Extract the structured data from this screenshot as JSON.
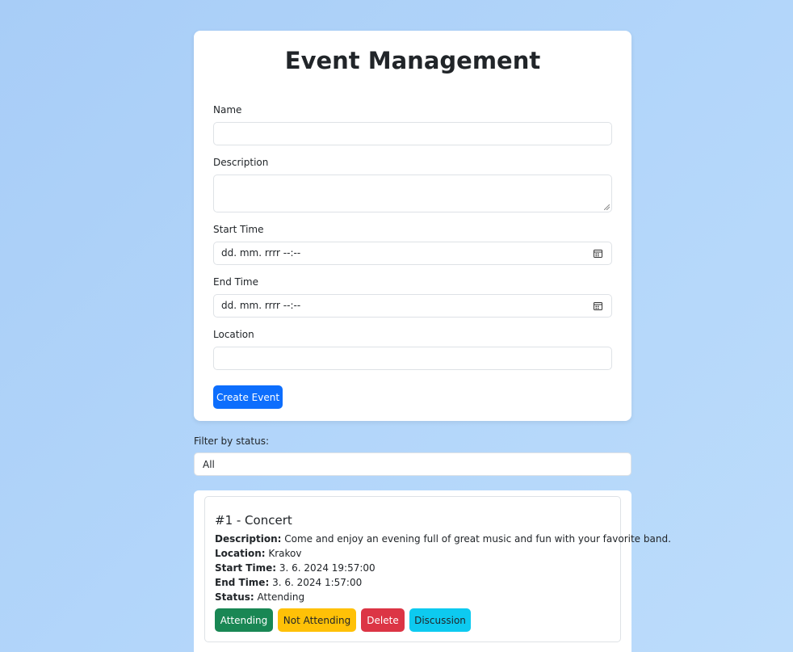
{
  "page": {
    "title": "Event Management"
  },
  "form": {
    "name_label": "Name",
    "name_value": "",
    "description_label": "Description",
    "description_value": "",
    "start_label": "Start Time",
    "start_placeholder": "dd. mm. rrrr --:--",
    "end_label": "End Time",
    "end_placeholder": "dd. mm. rrrr --:--",
    "location_label": "Location",
    "location_value": "",
    "submit_label": "Create Event"
  },
  "filter": {
    "label": "Filter by status:",
    "selected": "All"
  },
  "events": [
    {
      "heading": "#1 - Concert",
      "description_label": "Description:",
      "description": "Come and enjoy an evening full of great music and fun with your favorite band.",
      "location_label": "Location:",
      "location": "Krakov",
      "start_label": "Start Time:",
      "start": "3. 6. 2024 19:57:00",
      "end_label": "End Time:",
      "end": "3. 6. 2024 1:57:00",
      "status_label": "Status:",
      "status": "Attending",
      "actions": {
        "attending": "Attending",
        "not_attending": "Not Attending",
        "delete": "Delete",
        "discussion": "Discussion"
      }
    }
  ]
}
